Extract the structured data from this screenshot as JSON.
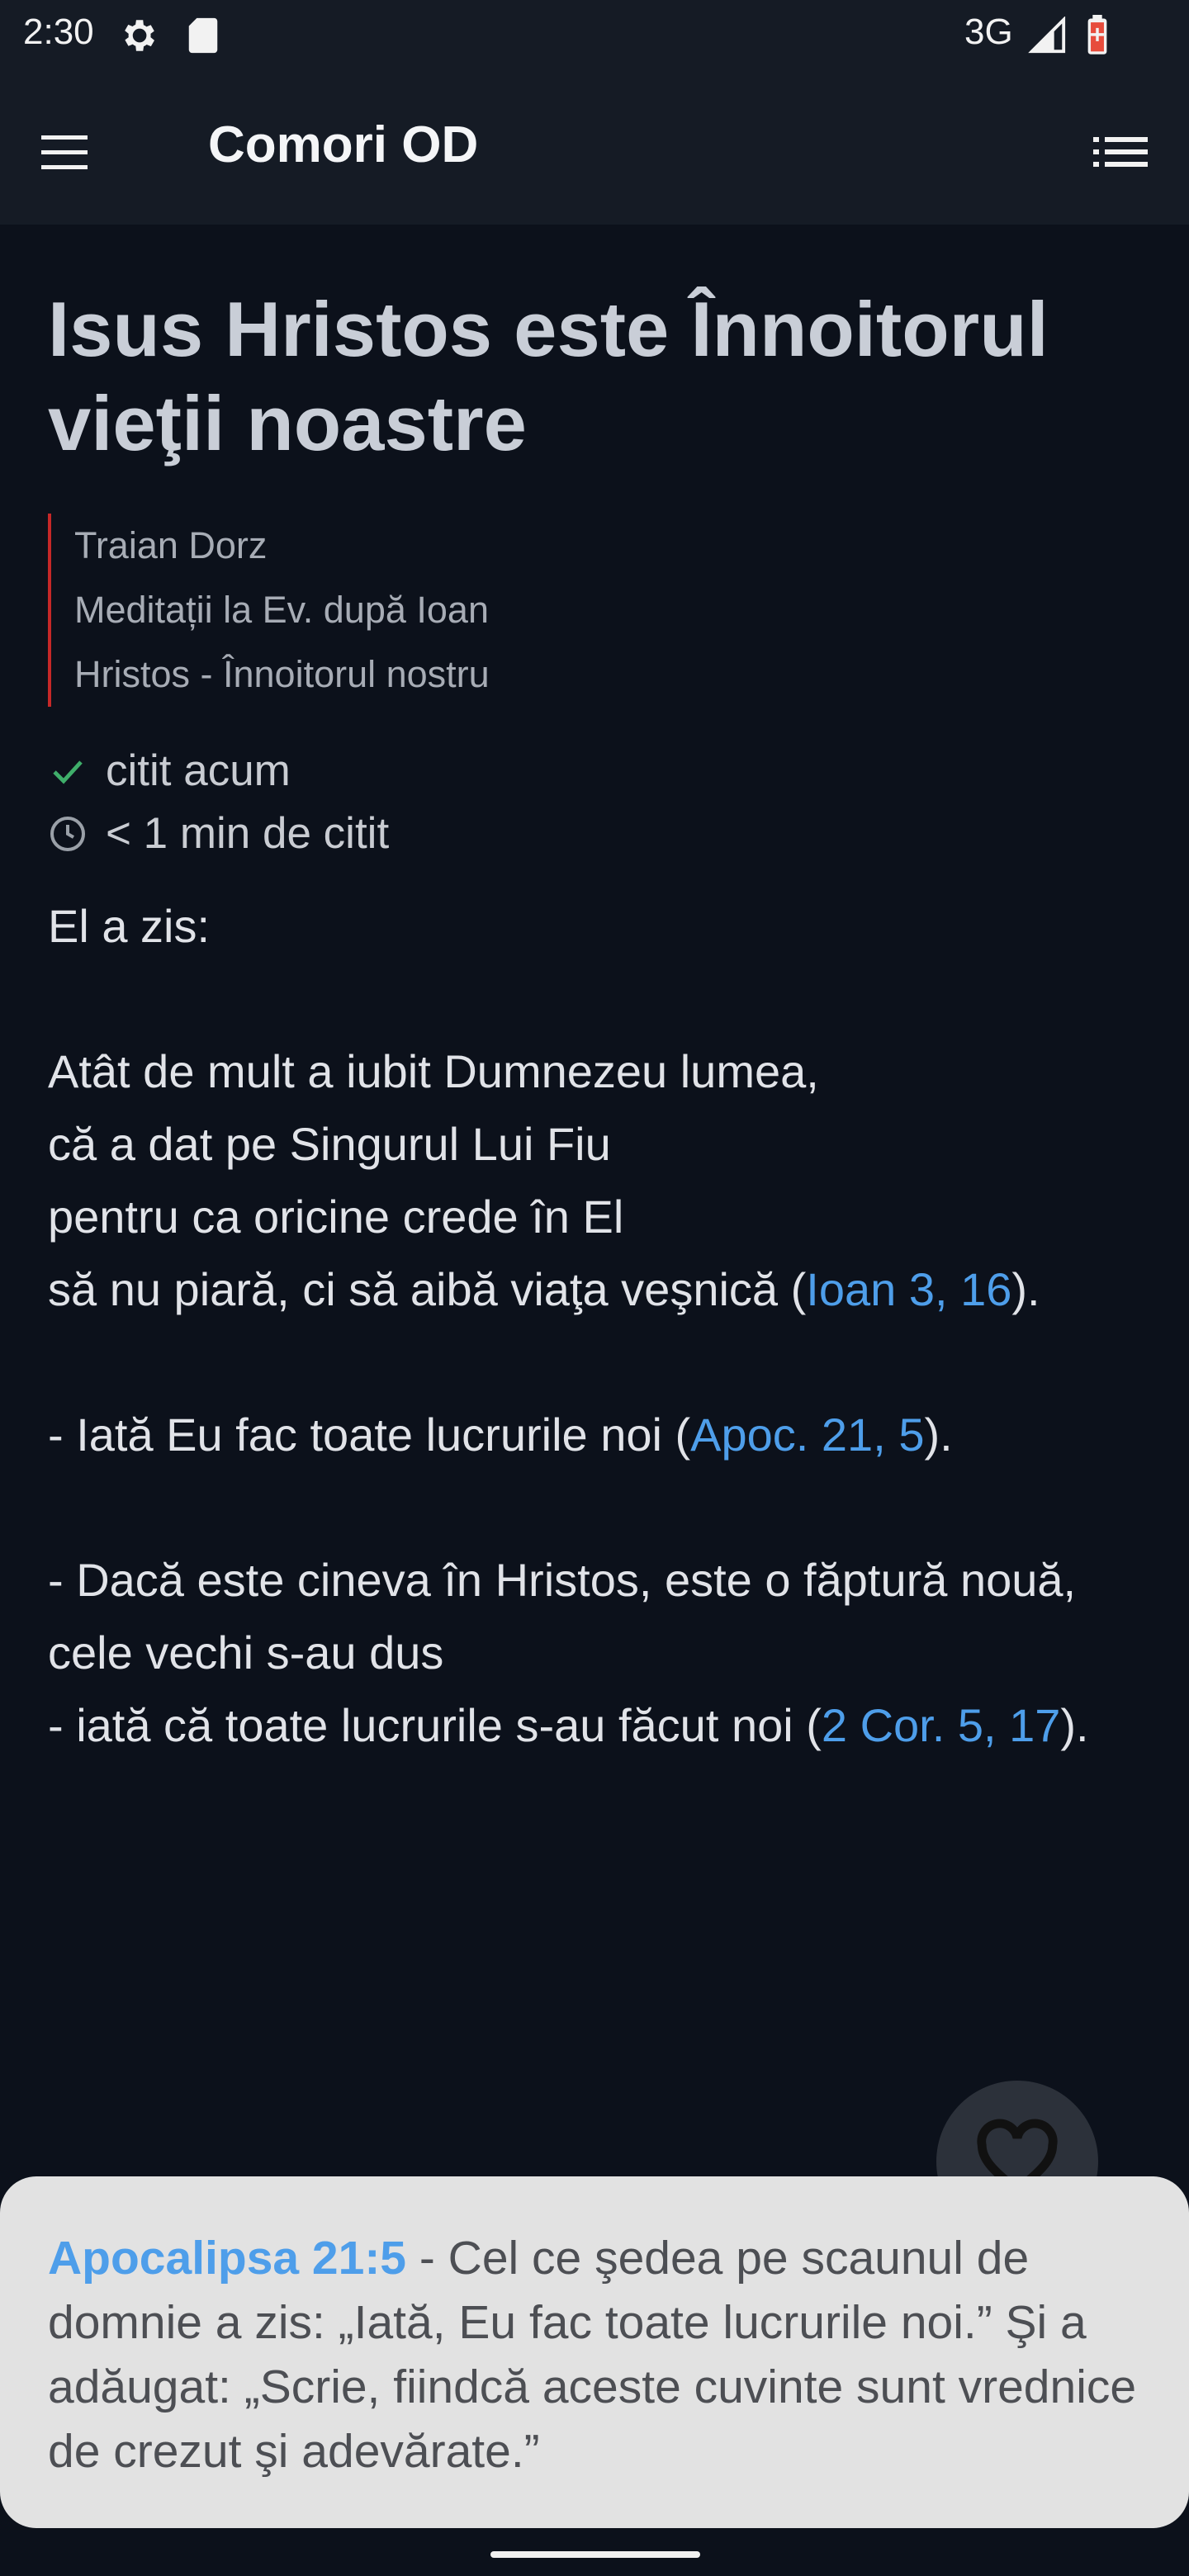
{
  "status_bar": {
    "time": "2:30",
    "network": "3G"
  },
  "app_bar": {
    "title": "Comori OD"
  },
  "article": {
    "title": "Isus Hristos este Înnoitorul vieţii noastre",
    "author": "Traian Dorz",
    "book": "Meditații la Ev. după Ioan",
    "section": "Hristos - Înnoitorul nostru",
    "read_status": "citit acum",
    "read_time": "< 1 min de citit",
    "body": {
      "p1": "El a zis:",
      "p2_text": "Atât de mult a iubit Dumnezeu lumea,\ncă a dat pe Singurul Lui Fiu\npentru ca oricine crede în El\nsă nu piară, ci să aibă viaţa veşnică (",
      "p2_ref": "Ioan 3, 16",
      "p3_text": "- Iată Eu fac toate lucrurile noi (",
      "p3_ref": "Apoc. 21, 5",
      "p4_text": "- Dacă este cineva în Hristos, este o făptură nouă,\ncele vechi s-au dus\n- iată că toate lucrurile s-au făcut noi (",
      "p4_ref": "2 Cor. 5, 17",
      "close_paren": ")."
    }
  },
  "verse_sheet": {
    "ref": "Apocalipsa 21:5",
    "text": " - Cel ce şedea pe scaunul de domnie a zis: „Iată, Eu fac toate lucrurile noi.” Şi a adăugat: „Scrie, fiindcă aceste cuvinte sunt vrednice de crezut şi adevărate.”"
  },
  "icons": {
    "menu": "hamburger-menu-icon",
    "toc": "list-icon",
    "favorite": "heart-outline-icon",
    "read": "check-icon",
    "time": "clock-icon"
  },
  "colors": {
    "background": "#0c111b",
    "bar": "#151b25",
    "link": "#4e9eea",
    "accent_border": "#c62828",
    "check": "#3fae6a",
    "sheet": "#e2e2e2"
  }
}
